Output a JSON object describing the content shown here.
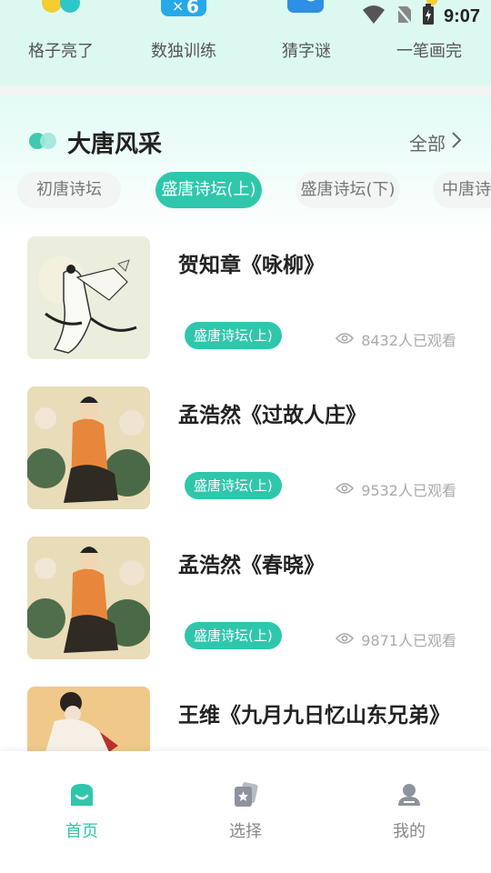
{
  "status_bar": {
    "time": "9:07"
  },
  "games": [
    {
      "label": "格子亮了",
      "icon": "dots-icon"
    },
    {
      "label": "数独训练",
      "icon": "sudoku-icon",
      "badge": "6"
    },
    {
      "label": "猜字谜",
      "icon": "magnifier-icon"
    },
    {
      "label": "一笔画完",
      "icon": "pen-icon"
    }
  ],
  "section": {
    "title": "大唐风采",
    "all_label": "全部"
  },
  "tabs": [
    {
      "label": "初唐诗坛",
      "active": false
    },
    {
      "label": "盛唐诗坛(上)",
      "active": true
    },
    {
      "label": "盛唐诗坛(下)",
      "active": false
    },
    {
      "label": "中唐诗坛",
      "active": false
    }
  ],
  "items": [
    {
      "title": "贺知章《咏柳》",
      "badge": "盛唐诗坛(上)",
      "views": "8432人已观看"
    },
    {
      "title": "孟浩然《过故人庄》",
      "badge": "盛唐诗坛(上)",
      "views": "9532人已观看"
    },
    {
      "title": "孟浩然《春晓》",
      "badge": "盛唐诗坛(上)",
      "views": "9871人已观看"
    },
    {
      "title": "王维《九月九日忆山东兄弟》",
      "badge": "",
      "views": ""
    }
  ],
  "bottom_nav": [
    {
      "label": "首页",
      "icon": "home-icon",
      "active": true
    },
    {
      "label": "选择",
      "icon": "star-cards-icon",
      "active": false
    },
    {
      "label": "我的",
      "icon": "profile-icon",
      "active": false
    }
  ],
  "colors": {
    "accent": "#2ec7ac",
    "top_band": "#dcf9f1"
  }
}
